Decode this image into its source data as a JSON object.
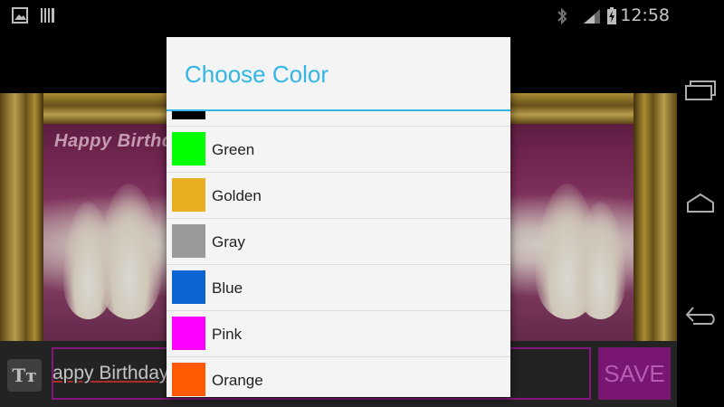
{
  "status_bar": {
    "time": "12:58"
  },
  "card": {
    "title": "Happy Birthday"
  },
  "bottom_bar": {
    "font_button_label": "Tт",
    "text_value": "appy Birthday",
    "save_label": "SAVE"
  },
  "dialog": {
    "title": "Choose Color",
    "colors": [
      {
        "name": "",
        "hex": "#000000"
      },
      {
        "name": "Green",
        "hex": "#00ff00"
      },
      {
        "name": "Golden",
        "hex": "#e8b020"
      },
      {
        "name": "Gray",
        "hex": "#9a9a9a"
      },
      {
        "name": "Blue",
        "hex": "#0a64d2"
      },
      {
        "name": "Pink",
        "hex": "#ff00ff"
      },
      {
        "name": "Orange",
        "hex": "#ff5a00"
      }
    ]
  },
  "theme": {
    "accent": "#33b5e5",
    "save_bg": "#8e1a86",
    "input_border": "#a01a94"
  }
}
